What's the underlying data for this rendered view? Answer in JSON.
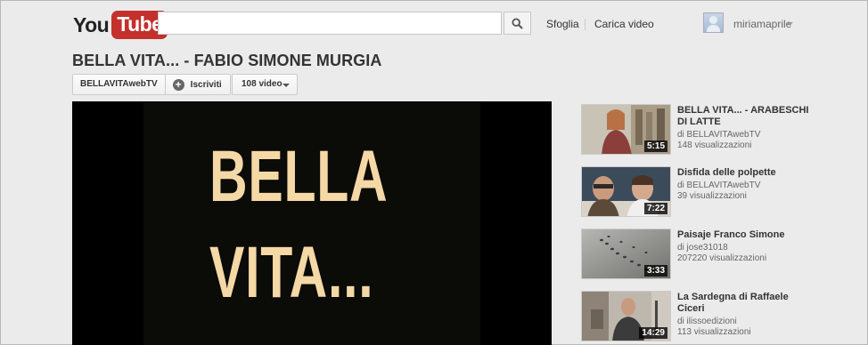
{
  "masthead": {
    "logo_you": "You",
    "logo_tube": "Tube",
    "search_placeholder": "",
    "browse_label": "Sfoglia",
    "upload_label": "Carica video",
    "username": "miriamaprile"
  },
  "video": {
    "title": "BELLA VITA... - FABIO SIMONE MURGIA",
    "channel": "BELLAVITAwebTV",
    "subscribe_label": "Iscriviti",
    "videos_count_label": "108 video",
    "player_text_line1": "BELLA",
    "player_text_line2": "VITA..."
  },
  "related": [
    {
      "title": "BELLA VITA... - ARABESCHI DI LATTE",
      "by": "di BELLAVITAwebTV",
      "views": "148 visualizzazioni",
      "duration": "5:15"
    },
    {
      "title": "Disfida delle polpette",
      "by": "di BELLAVITAwebTV",
      "views": "39 visualizzazioni",
      "duration": "7:22"
    },
    {
      "title": "Paisaje Franco Simone",
      "by": "di jose31018",
      "views": "207220 visualizzazioni",
      "duration": "3:33"
    },
    {
      "title": "La Sardegna di Raffaele Ciceri",
      "by": "di ilissoedizioni",
      "views": "113 visualizzazioni",
      "duration": "14:29"
    }
  ],
  "colors": {
    "brand_red": "#c4302b",
    "title_cream": "#f4d8a6",
    "page_bg": "#ebebeb"
  }
}
